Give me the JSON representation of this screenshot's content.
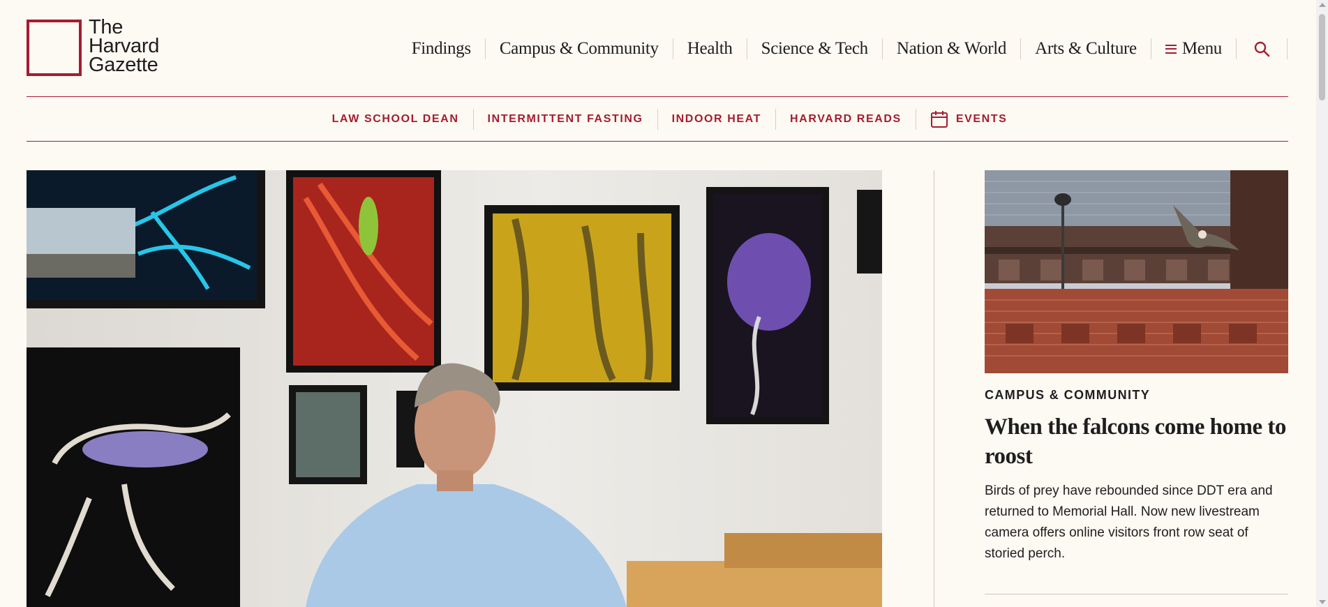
{
  "logo": {
    "lines": [
      "The",
      "Harvard",
      "Gazette"
    ]
  },
  "colors": {
    "brand": "#a51c30",
    "background": "#fdf9f3",
    "text": "#1e1e1e"
  },
  "nav": {
    "items": [
      "Findings",
      "Campus & Community",
      "Health",
      "Science & Tech",
      "Nation & World",
      "Arts & Culture"
    ],
    "menu_label": "Menu",
    "menu_icon": "hamburger-icon",
    "search_icon": "search-icon"
  },
  "trending": {
    "items": [
      "LAW SCHOOL DEAN",
      "INTERMITTENT FASTING",
      "INDOOR HEAT",
      "HARVARD READS"
    ],
    "events_label": "EVENTS",
    "events_icon": "calendar-icon"
  },
  "hero": {
    "image_icon": "photo-icon"
  },
  "side_story": {
    "category": "CAMPUS & COMMUNITY",
    "title": "When the falcons come home to roost",
    "description": "Birds of prey have rebounded since DDT era and returned to Memorial Hall. Now new livestream camera offers online visitors front row seat of storied perch."
  }
}
